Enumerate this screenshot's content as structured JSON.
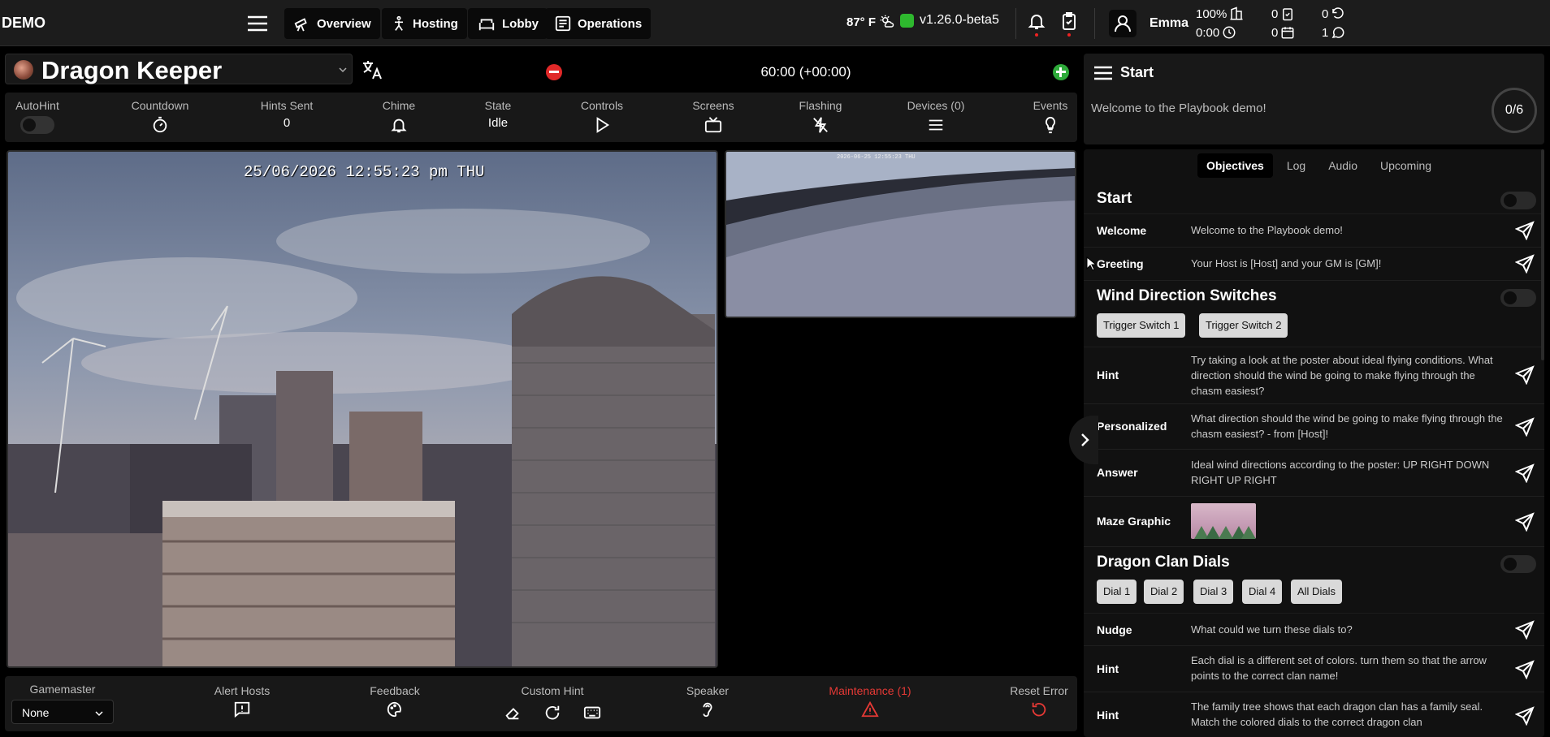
{
  "app": {
    "logo": "DEMO"
  },
  "nav": [
    {
      "label": "Overview",
      "icon": "telescope-icon",
      "active": true
    },
    {
      "label": "Hosting",
      "icon": "person-icon"
    },
    {
      "label": "Lobby",
      "icon": "couch-icon"
    },
    {
      "label": "Operations",
      "icon": "list-icon"
    }
  ],
  "header": {
    "weather": "87° F",
    "version": "v1.26.0-beta5",
    "user": "Emma",
    "stats": {
      "battery": "100%",
      "time": "0:00",
      "tasks": "0",
      "scheduled": "0",
      "refresh": "0",
      "messages": "1"
    }
  },
  "game": {
    "title": "Dragon Keeper",
    "timer": "60:00 (+00:00)"
  },
  "controls": [
    {
      "label": "AutoHint",
      "type": "toggle"
    },
    {
      "label": "Countdown",
      "icon": "stopwatch-icon"
    },
    {
      "label": "Hints Sent",
      "value": "0"
    },
    {
      "label": "Chime",
      "icon": "bell-icon"
    },
    {
      "label": "State",
      "value": "Idle"
    },
    {
      "label": "Controls",
      "icon": "play-icon"
    },
    {
      "label": "Screens",
      "icon": "tv-icon"
    },
    {
      "label": "Flashing",
      "icon": "flash-off-icon"
    },
    {
      "label": "Devices (0)",
      "icon": "menu-icon"
    },
    {
      "label": "Events",
      "icon": "lightbulb-icon"
    }
  ],
  "cameras": {
    "main_timestamp": "25/06/2026 12:55:23 pm THU",
    "second_timestamp": "2026-06-25 12:55:23 THU"
  },
  "bottom": {
    "gamemaster_label": "Gamemaster",
    "gamemaster_value": "None",
    "items": [
      {
        "label": "Alert Hosts"
      },
      {
        "label": "Feedback"
      },
      {
        "label": "Custom Hint"
      },
      {
        "label": "Speaker"
      },
      {
        "label": "Maintenance (1)",
        "color": "#e53935"
      },
      {
        "label": "Reset Error"
      }
    ]
  },
  "panel": {
    "title": "Start",
    "welcome": "Welcome to the Playbook demo!",
    "progress": "0/6",
    "tabs": [
      "Objectives",
      "Log",
      "Audio",
      "Upcoming"
    ],
    "sections": [
      {
        "title": "Start",
        "rows": [
          {
            "label": "Welcome",
            "text": "Welcome to the Playbook demo!"
          },
          {
            "label": "Greeting",
            "text": "Your Host is [Host] and your GM is [GM]!"
          }
        ]
      },
      {
        "title": "Wind Direction Switches",
        "buttons": [
          "Trigger Switch 1",
          "Trigger Switch 2"
        ],
        "rows": [
          {
            "label": "Hint",
            "text": "Try taking a look at the poster about ideal flying conditions. What direction should the wind be going to make flying through the chasm easiest?"
          },
          {
            "label": "Personalized",
            "text": "What direction should the wind be going to make flying through the chasm easiest? - from [Host]!"
          },
          {
            "label": "Answer",
            "text": "Ideal wind directions according to the poster: UP RIGHT DOWN RIGHT UP RIGHT"
          },
          {
            "label": "Maze Graphic",
            "text": ""
          }
        ]
      },
      {
        "title": "Dragon Clan Dials",
        "buttons": [
          "Dial 1",
          "Dial 2",
          "Dial 3",
          "Dial 4",
          "All Dials"
        ],
        "rows": [
          {
            "label": "Nudge",
            "text": "What could we turn these dials to?"
          },
          {
            "label": "Hint",
            "text": "Each dial is a different set of colors. turn them so that the arrow points to the correct clan name!"
          },
          {
            "label": "Hint",
            "text": "The family tree shows that each dragon clan has a family seal. Match the colored dials to the correct dragon clan"
          }
        ]
      }
    ]
  }
}
